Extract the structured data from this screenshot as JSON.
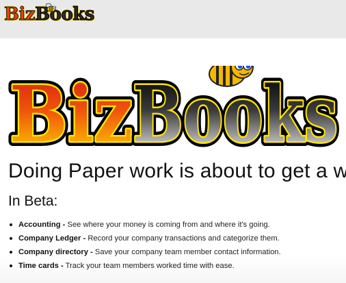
{
  "header": {
    "logo_biz": "Biz",
    "logo_books": "Books"
  },
  "hero": {
    "logo_biz": "Biz",
    "logo_books": "Books",
    "tagline": "Doing Paper work is about to get a w",
    "beta_heading": "In Beta:"
  },
  "features": [
    {
      "name": "Accounting -",
      "desc": " See where your money is coming from and where it's going."
    },
    {
      "name": "Company Ledger -",
      "desc": " Record your company transactions and categorize them."
    },
    {
      "name": "Company directory -",
      "desc": " Save your company team member contact information."
    },
    {
      "name": "Time cards -",
      "desc": " Track your team members worked time with ease."
    }
  ],
  "colors": {
    "biz_fill_top": "#d61e10",
    "biz_fill_bottom": "#ffd800",
    "books_fill_top": "#000000",
    "books_fill_bottom": "#ffffff",
    "outline_yellow": "#ffe600",
    "bee_body": "#f5b800"
  }
}
